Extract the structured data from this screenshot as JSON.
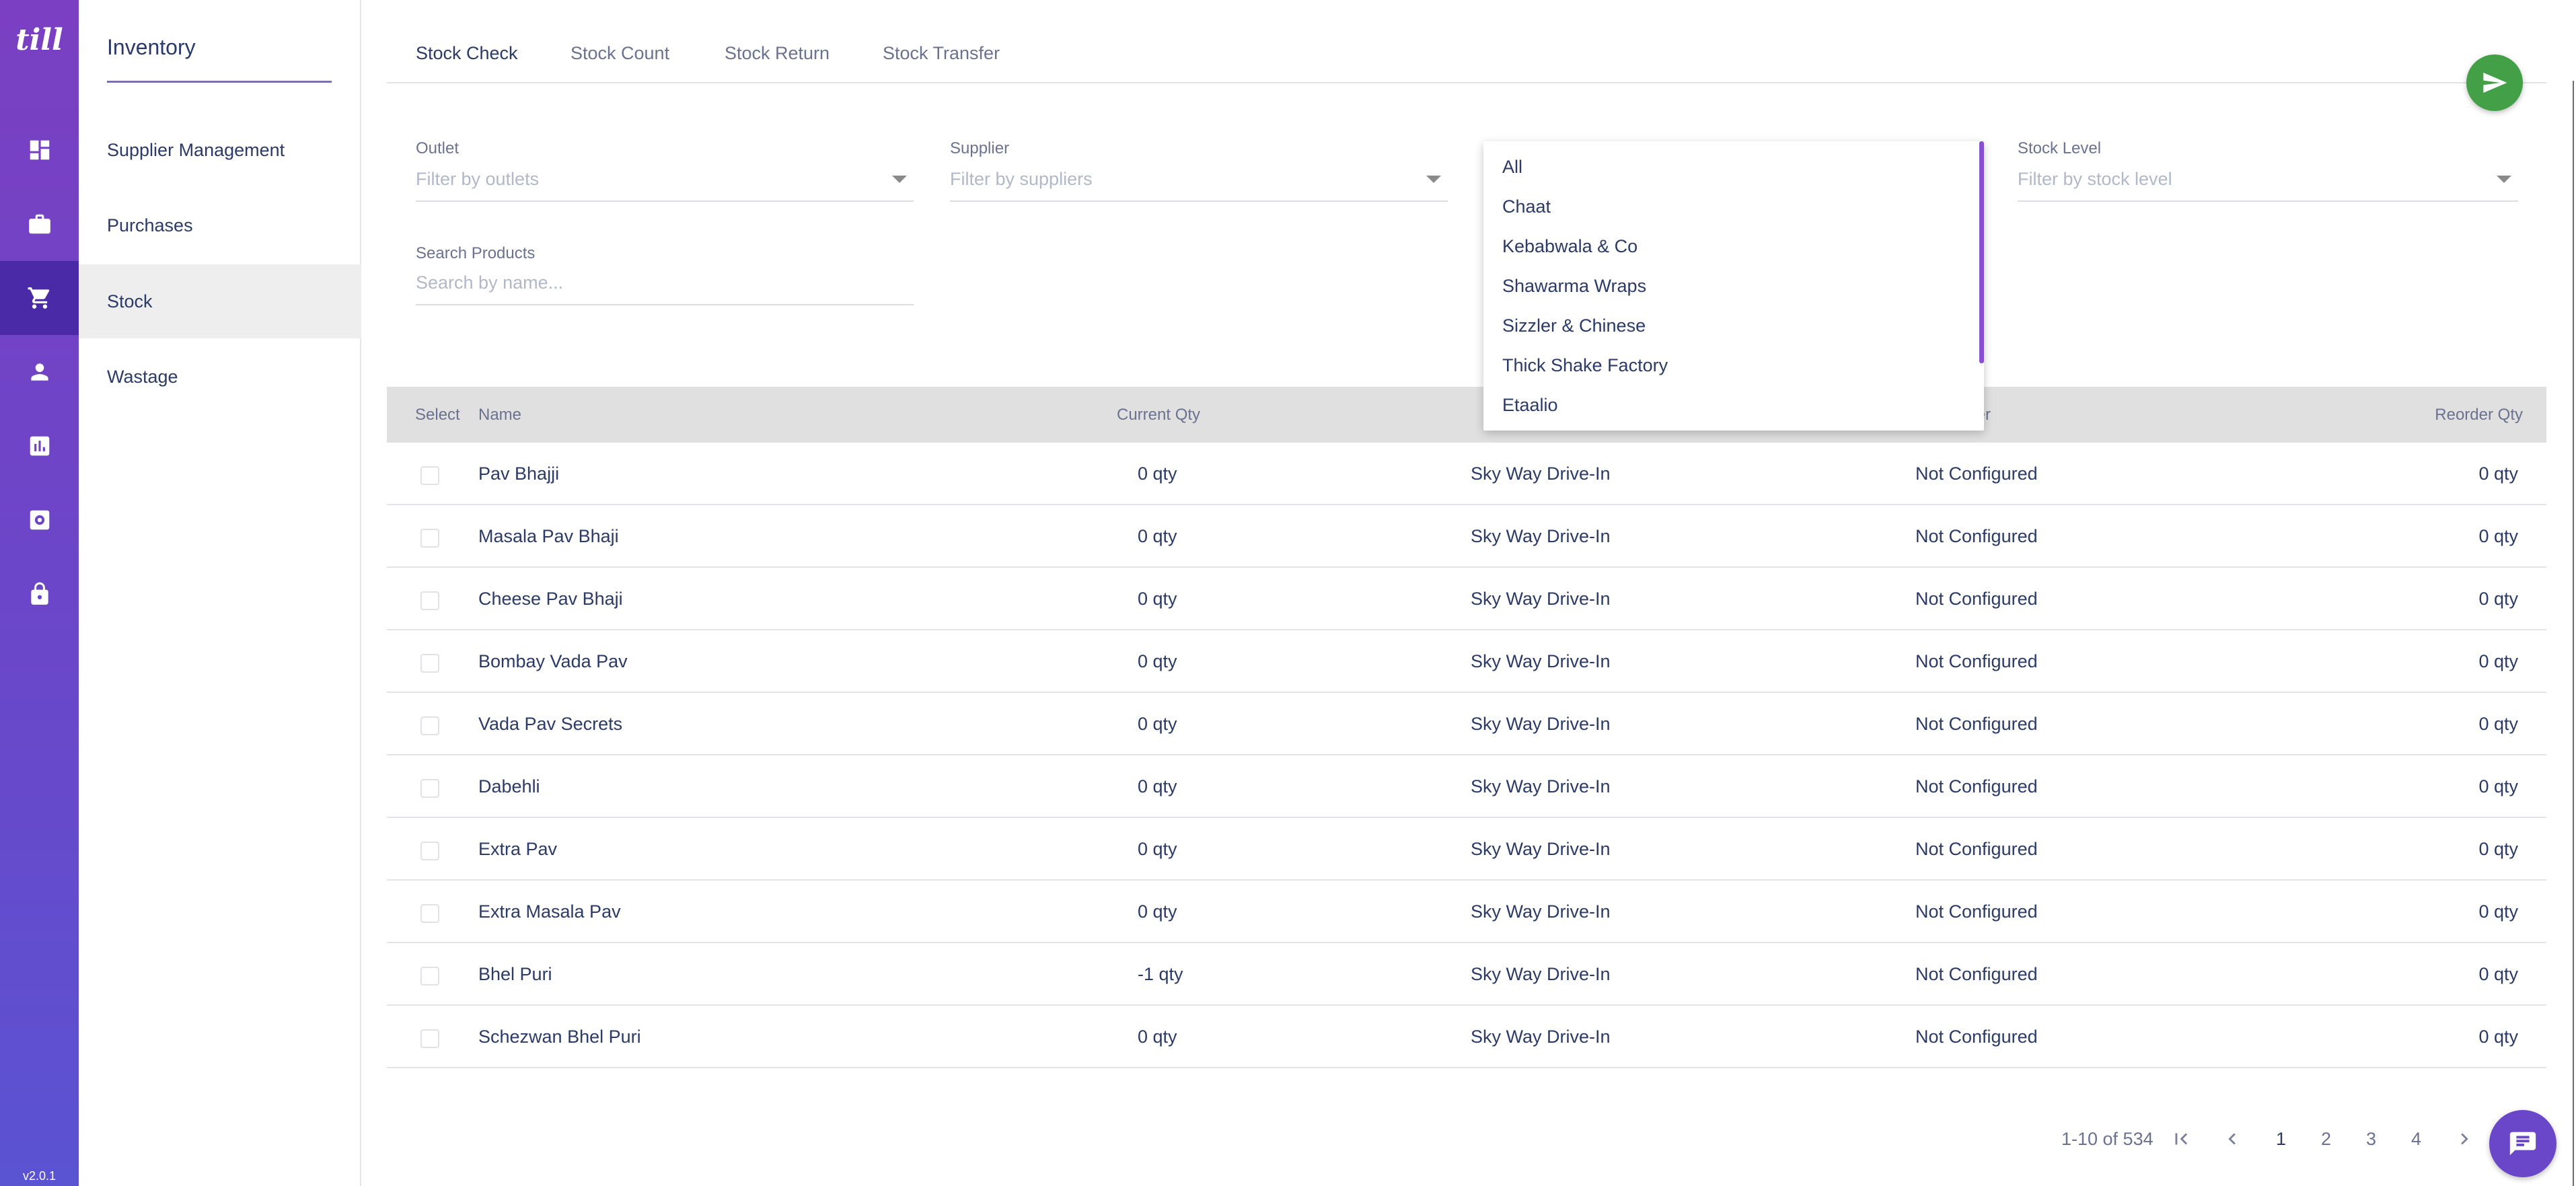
{
  "rail": {
    "logo": "till",
    "version": "v2.0.1",
    "items": [
      {
        "icon": "dashboard-icon"
      },
      {
        "icon": "briefcase-icon"
      },
      {
        "icon": "cart-icon"
      },
      {
        "icon": "person-icon"
      },
      {
        "icon": "bar-chart-icon"
      },
      {
        "icon": "settings-icon"
      },
      {
        "icon": "lock-icon"
      }
    ]
  },
  "subnav": {
    "title": "Inventory",
    "links": [
      "Supplier Management",
      "Purchases",
      "Stock",
      "Wastage"
    ],
    "active": "Stock"
  },
  "tabs": [
    "Stock Check",
    "Stock Count",
    "Stock Return",
    "Stock Transfer"
  ],
  "filters": {
    "outlet": {
      "label": "Outlet",
      "placeholder": "Filter by outlets"
    },
    "supplier": {
      "label": "Supplier",
      "placeholder": "Filter by suppliers"
    },
    "stock_level": {
      "label": "Stock Level",
      "placeholder": "Filter by stock level"
    },
    "search": {
      "label": "Search Products",
      "placeholder": "Search by name..."
    }
  },
  "dropdown_options": [
    "All",
    "Chaat",
    "Kebabwala & Co",
    "Shawarma Wraps",
    "Sizzler & Chinese",
    "Thick Shake Factory",
    "Etaalio"
  ],
  "table": {
    "headers": {
      "select": "Select",
      "name": "Name",
      "current_qty": "Current Qty",
      "supplier_partial": "lier",
      "reorder_qty": "Reorder Qty"
    },
    "rows": [
      {
        "name": "Pav Bhajji",
        "qty": "0 qty",
        "outlet": "Sky Way Drive-In",
        "supplier": "Not Configured",
        "reorder": "0 qty"
      },
      {
        "name": "Masala Pav Bhaji",
        "qty": "0 qty",
        "outlet": "Sky Way Drive-In",
        "supplier": "Not Configured",
        "reorder": "0 qty"
      },
      {
        "name": "Cheese Pav Bhaji",
        "qty": "0 qty",
        "outlet": "Sky Way Drive-In",
        "supplier": "Not Configured",
        "reorder": "0 qty"
      },
      {
        "name": "Bombay Vada Pav",
        "qty": "0 qty",
        "outlet": "Sky Way Drive-In",
        "supplier": "Not Configured",
        "reorder": "0 qty"
      },
      {
        "name": "Vada Pav Secrets",
        "qty": "0 qty",
        "outlet": "Sky Way Drive-In",
        "supplier": "Not Configured",
        "reorder": "0 qty"
      },
      {
        "name": "Dabehli",
        "qty": "0 qty",
        "outlet": "Sky Way Drive-In",
        "supplier": "Not Configured",
        "reorder": "0 qty"
      },
      {
        "name": "Extra Pav",
        "qty": "0 qty",
        "outlet": "Sky Way Drive-In",
        "supplier": "Not Configured",
        "reorder": "0 qty"
      },
      {
        "name": "Extra Masala Pav",
        "qty": "0 qty",
        "outlet": "Sky Way Drive-In",
        "supplier": "Not Configured",
        "reorder": "0 qty"
      },
      {
        "name": "Bhel Puri",
        "qty": "-1 qty",
        "outlet": "Sky Way Drive-In",
        "supplier": "Not Configured",
        "reorder": "0 qty"
      },
      {
        "name": "Schezwan Bhel Puri",
        "qty": "0 qty",
        "outlet": "Sky Way Drive-In",
        "supplier": "Not Configured",
        "reorder": "0 qty"
      }
    ]
  },
  "pagination": {
    "range": "1-10 of 534",
    "pages": [
      "1",
      "2",
      "3",
      "4"
    ],
    "current": "1"
  },
  "colors": {
    "rail_top": "#7a3fc2",
    "rail_bottom": "#5a53d2",
    "fab": "#43a047",
    "text": "#2b3a67"
  }
}
